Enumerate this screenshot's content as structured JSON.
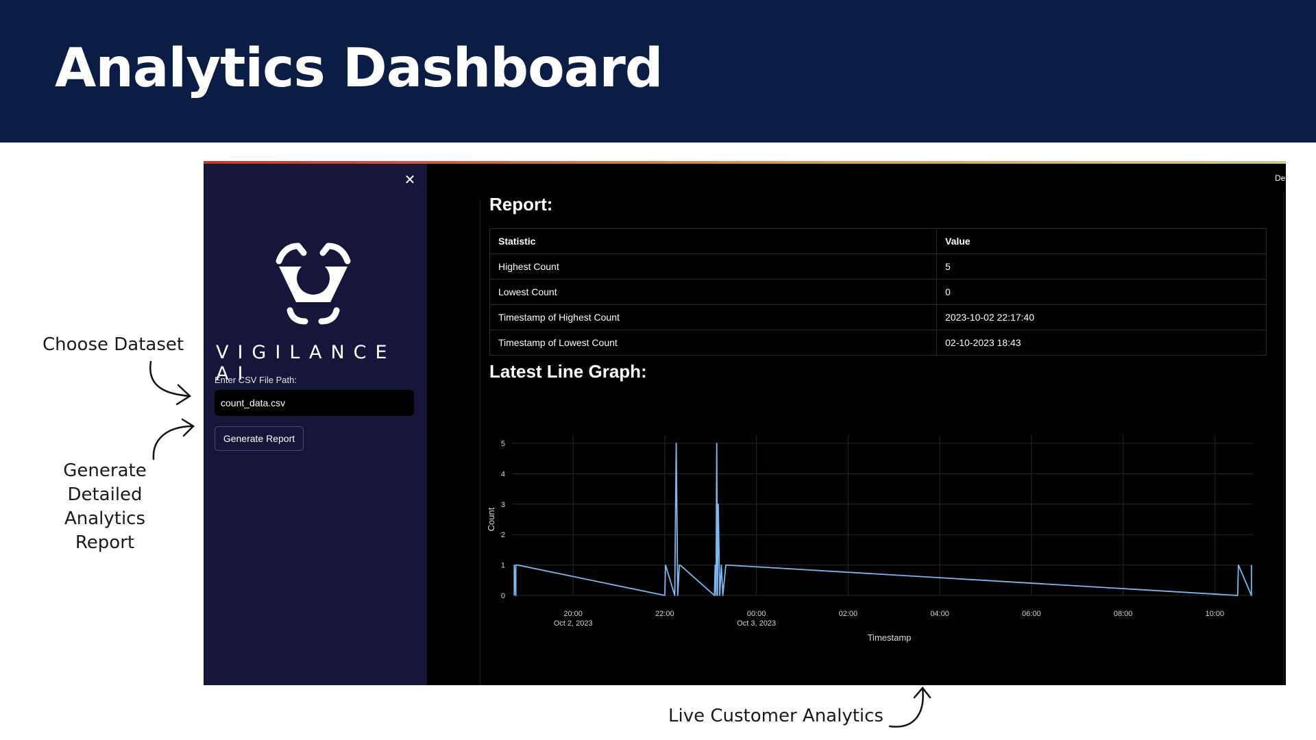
{
  "header": {
    "title": "Analytics Dashboard"
  },
  "annotations": {
    "choose_dataset": "Choose Dataset",
    "generate_report_lines": [
      "Generate",
      "Detailed",
      "Analytics",
      "Report"
    ],
    "live_customer": "Live Customer Analytics"
  },
  "sidebar": {
    "close_icon": "close-icon",
    "brand": "VIGILANCE AI",
    "csv_label": "Enter CSV File Path:",
    "csv_value": "count_data.csv",
    "generate_button": "Generate Report"
  },
  "main": {
    "deploy_label": "Deploy",
    "report_title": "Report:",
    "table": {
      "headers": [
        "Statistic",
        "Value"
      ],
      "rows": [
        [
          "Highest Count",
          "5"
        ],
        [
          "Lowest Count",
          "0"
        ],
        [
          "Timestamp of Highest Count",
          "2023-10-02 22:17:40"
        ],
        [
          "Timestamp of Lowest Count",
          "02-10-2023 18:43"
        ]
      ]
    },
    "graph_title": "Latest Line Graph:"
  },
  "colors": {
    "header_bg": "#0b1d45",
    "sidebar_bg": "#15163a",
    "line": "#7db8f0"
  },
  "chart_data": {
    "type": "line",
    "xlabel": "Timestamp",
    "ylabel": "Count",
    "ylim": [
      0,
      5
    ],
    "yticks": [
      0,
      1,
      2,
      3,
      4,
      5
    ],
    "xticks": [
      {
        "t": "2023-10-02 20:00",
        "label": "20:00",
        "sub": "Oct 2, 2023"
      },
      {
        "t": "2023-10-02 22:00",
        "label": "22:00",
        "sub": ""
      },
      {
        "t": "2023-10-03 00:00",
        "label": "00:00",
        "sub": "Oct 3, 2023"
      },
      {
        "t": "2023-10-03 02:00",
        "label": "02:00",
        "sub": ""
      },
      {
        "t": "2023-10-03 04:00",
        "label": "04:00",
        "sub": ""
      },
      {
        "t": "2023-10-03 06:00",
        "label": "06:00",
        "sub": ""
      },
      {
        "t": "2023-10-03 08:00",
        "label": "08:00",
        "sub": ""
      },
      {
        "t": "2023-10-03 10:00",
        "label": "10:00",
        "sub": ""
      }
    ],
    "xlim": [
      "2023-10-02 18:40",
      "2023-10-03 10:50"
    ],
    "grid": true,
    "series": [
      {
        "x": [
          "2023-10-02 18:43",
          "2023-10-02 18:43",
          "2023-10-02 18:45",
          "2023-10-02 18:45",
          "2023-10-02 18:47",
          "2023-10-02 22:00",
          "2023-10-02 22:01",
          "2023-10-02 22:13",
          "2023-10-02 22:15",
          "2023-10-02 22:17",
          "2023-10-02 22:19",
          "2023-10-02 22:20",
          "2023-10-02 23:05",
          "2023-10-02 23:06",
          "2023-10-02 23:07",
          "2023-10-02 23:08",
          "2023-10-02 23:09",
          "2023-10-02 23:10",
          "2023-10-02 23:12",
          "2023-10-02 23:14",
          "2023-10-02 23:16",
          "2023-10-02 23:20",
          "2023-10-03 10:30",
          "2023-10-03 10:31",
          "2023-10-03 10:48",
          "2023-10-03 10:48"
        ],
        "y": [
          0,
          1,
          0,
          1,
          1,
          0,
          1,
          0,
          5,
          0,
          1,
          1,
          0,
          1,
          0,
          5,
          0,
          3,
          0,
          1,
          0,
          1,
          0,
          1,
          0,
          1
        ]
      }
    ]
  }
}
